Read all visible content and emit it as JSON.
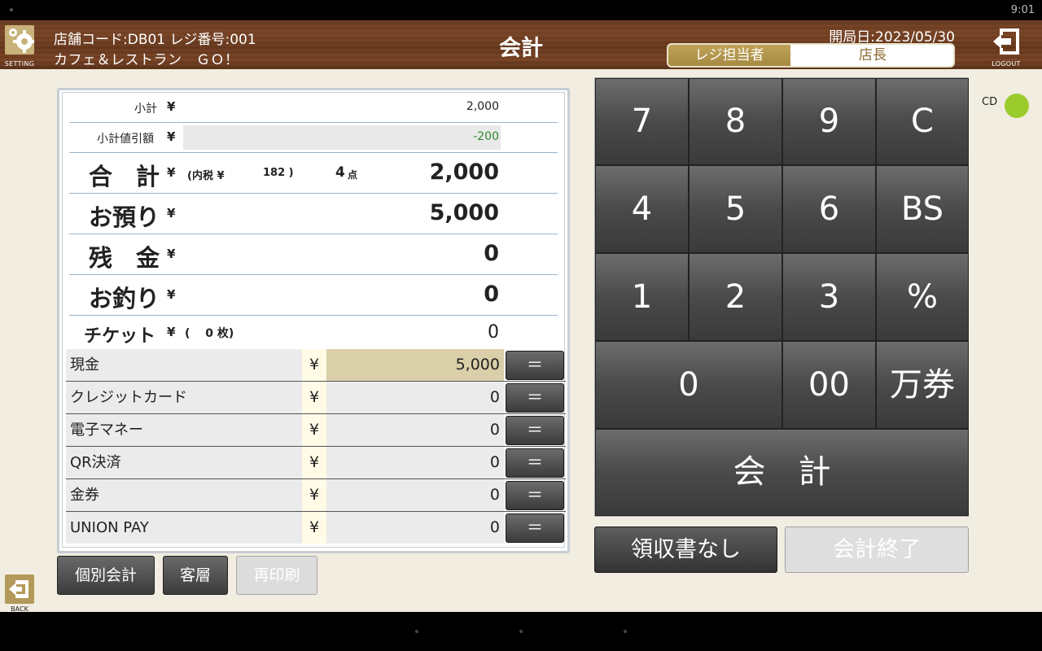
{
  "status_bar": {
    "time": "9:01"
  },
  "header": {
    "settings_caption": "SETTING",
    "store_line1": "店舗コード:DB01 レジ番号:001",
    "store_line2": "カフェ＆レストラン　ＧＯ！",
    "title": "会計",
    "open_date": "開局日:2023/05/30",
    "staff_label": "レジ担当者",
    "staff_name": "店長",
    "logout_caption": "LOGOUT",
    "brand_color": "#6e3d21",
    "accent_color": "#b09448"
  },
  "summary": {
    "subtotal": {
      "label": "小計",
      "yen": "¥",
      "value": "2,000"
    },
    "discount": {
      "label": "小計値引額",
      "yen": "¥",
      "value": "-200"
    },
    "total": {
      "label": "合　計",
      "yen": "¥",
      "tax_label": "(内税 ¥",
      "tax_value": "182 )",
      "count_value": "4",
      "count_unit": "点",
      "value": "2,000"
    },
    "received": {
      "label": "お預り",
      "yen": "¥",
      "value": "5,000"
    },
    "balance": {
      "label": "残　金",
      "yen": "¥",
      "value": "0"
    },
    "change": {
      "label": "お釣り",
      "yen": "¥",
      "value": "0"
    },
    "ticket": {
      "label": "チケット",
      "yen": "¥",
      "count_text": "(　 0 枚)",
      "value": "0"
    }
  },
  "payments": [
    {
      "label": "現金",
      "yen": "¥",
      "amount": "5,000",
      "button": "＝"
    },
    {
      "label": "クレジットカード",
      "yen": "¥",
      "amount": "0",
      "button": "＝"
    },
    {
      "label": "電子マネー",
      "yen": "¥",
      "amount": "0",
      "button": "＝"
    },
    {
      "label": "QR決済",
      "yen": "¥",
      "amount": "0",
      "button": "＝"
    },
    {
      "label": "金券",
      "yen": "¥",
      "amount": "0",
      "button": "＝"
    },
    {
      "label": "UNION PAY",
      "yen": "¥",
      "amount": "0",
      "button": "＝"
    }
  ],
  "footer_buttons": {
    "split": "個別会計",
    "customer": "客層",
    "reprint": "再印刷"
  },
  "keypad": {
    "k7": "7",
    "k8": "8",
    "k9": "9",
    "clear": "C",
    "k4": "4",
    "k5": "5",
    "k6": "6",
    "backspace": "BS",
    "k1": "1",
    "k2": "2",
    "k3": "3",
    "percent": "%",
    "k0": "0",
    "k00": "00",
    "voucher": "万券",
    "checkout": "会　計"
  },
  "actions": {
    "no_receipt": "領収書なし",
    "finish": "会計終了"
  },
  "cash_drawer": {
    "label": "CD",
    "status_color": "#9ccb2e"
  },
  "back_caption": "BACK"
}
